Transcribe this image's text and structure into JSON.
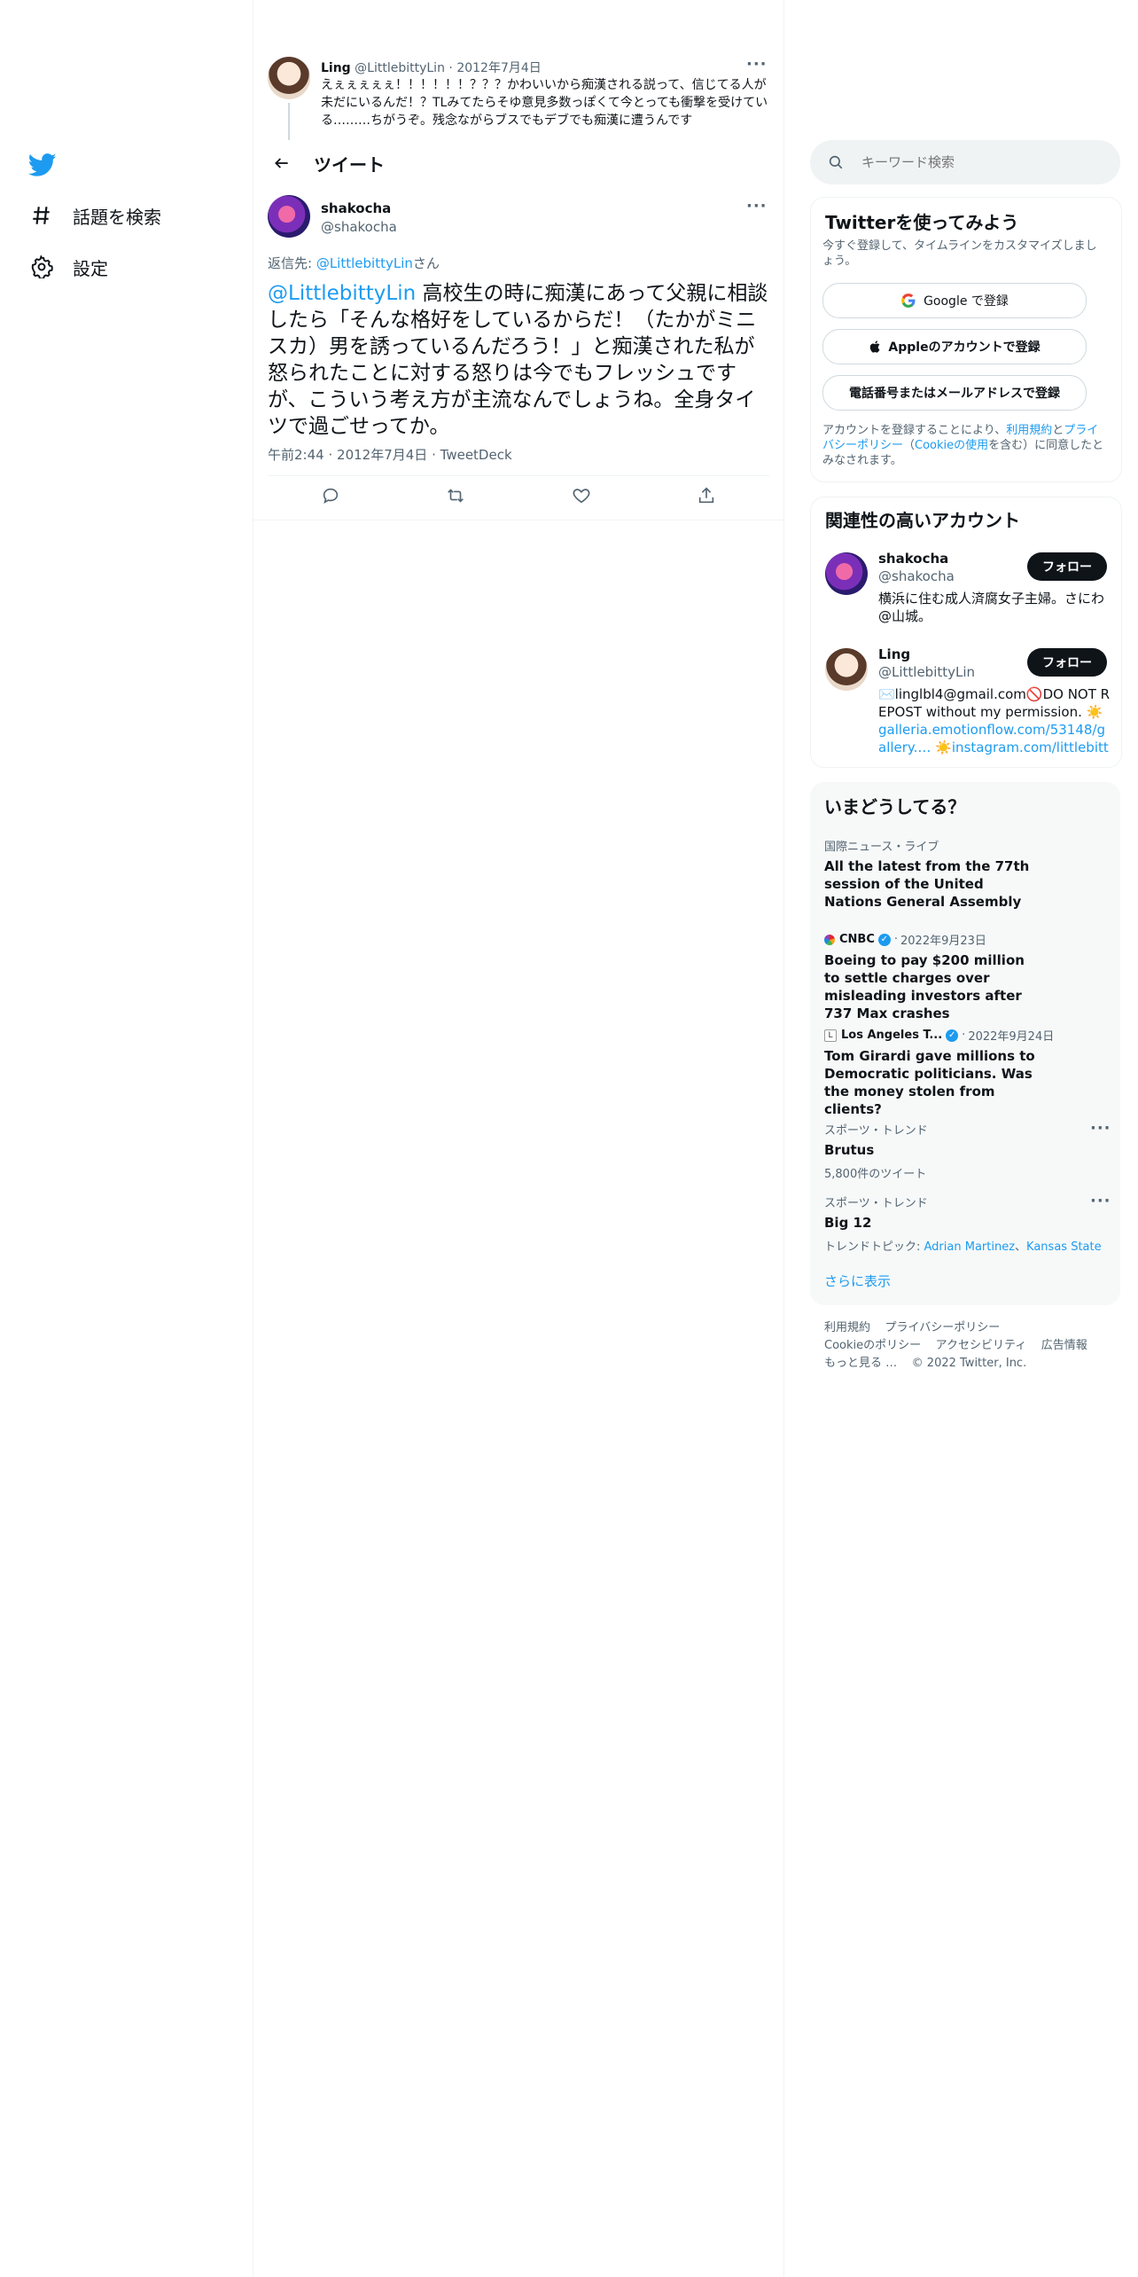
{
  "nav": {
    "explore_label": "話題を検索",
    "settings_label": "設定"
  },
  "parent_tweet": {
    "name": "Ling",
    "handle": "@LittlebittyLin",
    "sep": "·",
    "date": "2012年7月4日",
    "text": "えぇぇぇぇぇ！！！！！！？？？かわいいから痴漢される説って、信じてる人が未だにいるんだ！？TLみてたらそゆ意見多数っぽくて今とっても衝撃を受けている………ちがうぞ。残念ながらブスでもデブでも痴漢に遭うんです"
  },
  "header": {
    "title": "ツイート"
  },
  "tweet": {
    "name": "shakocha",
    "handle": "@shakocha",
    "reply_prefix": "返信先: ",
    "reply_to": "@LittlebittyLin",
    "reply_suffix": "さん",
    "mention": "@LittlebittyLin",
    "body": " 高校生の時に痴漢にあって父親に相談したら「そんな格好をしているからだ！（たかがミニスカ）男を誘っているんだろう！」と痴漢された私が怒られたことに対する怒りは今でもフレッシュですが、こういう考え方が主流なんでしょうね。全身タイツで過ごせってか。",
    "time": "午前2:44",
    "sep1": "·",
    "date": "2012年7月4日",
    "sep2": "·",
    "source": "TweetDeck"
  },
  "search": {
    "placeholder": "キーワード検索"
  },
  "signup": {
    "title": "Twitterを使ってみよう",
    "subtitle": "今すぐ登録して、タイムラインをカスタマイズしましょう。",
    "google_label": "Google で登録",
    "apple_label": "Appleのアカウントで登録",
    "phone_label": "電話番号またはメールアドレスで登録",
    "legal_1": "アカウントを登録することにより、",
    "legal_terms": "利用規約",
    "legal_2": "と",
    "legal_privacy": "プライバシーポリシー",
    "legal_3": "（",
    "legal_cookie": "Cookieの使用",
    "legal_4": "を含む）に同意したとみなされます。"
  },
  "related": {
    "title": "関連性の高いアカウント",
    "accounts": [
      {
        "name": "shakocha",
        "handle": "@shakocha",
        "follow": "フォロー",
        "bio": "横浜に住む成人済腐女子主婦。さにわ@山城。"
      },
      {
        "name": "Ling",
        "handle": "@LittlebittyLin",
        "follow": "フォロー",
        "bio_a": "✉️linglbl4@gmail.com🚫DO NOT REPOST without my permission. ☀️",
        "bio_link1": "galleria.emotionflow.com/53148/gallery.…",
        "bio_b": " ☀️",
        "bio_link2": "instagram.com/littlebittylin_"
      }
    ]
  },
  "trends": {
    "title": "いまどうしてる？",
    "items": [
      {
        "meta": "国際ニュース・ライブ",
        "text": "All the latest from the 77th session of the United Nations General Assembly"
      },
      {
        "source": "CNBC",
        "sep": "·",
        "date": "2022年9月23日",
        "text": "Boeing to pay $200 million to settle charges over misleading investors after 737 Max crashes"
      },
      {
        "source": "Los Angeles T...",
        "sep": "·",
        "date": "2022年9月24日",
        "text": "Tom Girardi gave millions to Democratic politicians. Was the money stolen from clients?"
      },
      {
        "meta": "スポーツ・トレンド",
        "text": "Brutus",
        "count": "5,800件のツイート"
      },
      {
        "meta": "スポーツ・トレンド",
        "text": "Big 12",
        "topic_label": "トレンドトピック: ",
        "topic_1": "Adrian Martinez",
        "topic_sep": "、",
        "topic_2": "Kansas State"
      }
    ],
    "show_more": "さらに表示"
  },
  "footer": {
    "terms": "利用規約",
    "privacy": "プライバシーポリシー",
    "cookie": "Cookieのポリシー",
    "accessibility": "アクセシビリティ",
    "ads": "広告情報",
    "more": "もっと見る …",
    "copyright": "© 2022 Twitter, Inc."
  },
  "colors": {
    "accent": "#1d9bf0",
    "text": "#0f1419",
    "muted": "#536471",
    "border": "#eff3f4",
    "panel": "#f7f9f9"
  }
}
